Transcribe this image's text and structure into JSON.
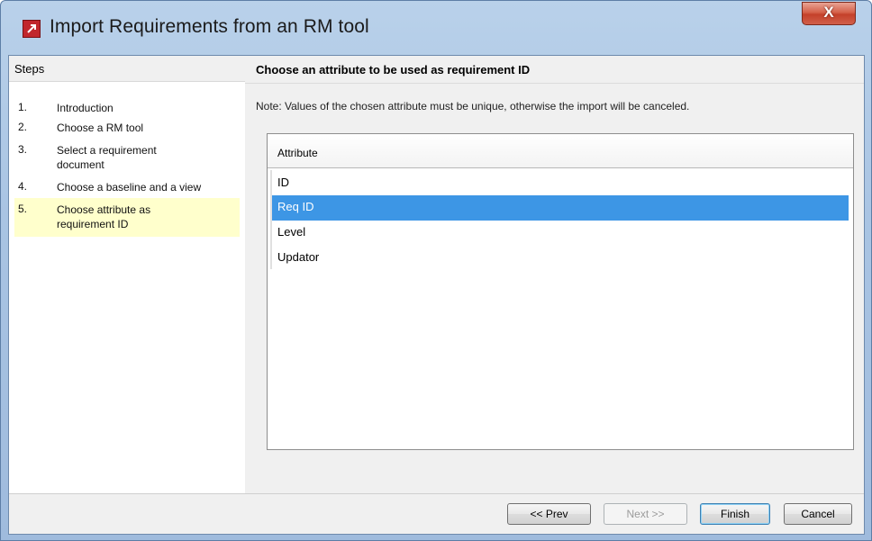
{
  "window": {
    "title": "Import Requirements from an RM tool",
    "app_icon": "import-requirements-app-icon",
    "close_label": "X"
  },
  "steps": {
    "header": "Steps",
    "items": [
      {
        "num": "1.",
        "label": "Introduction",
        "active": false
      },
      {
        "num": "2.",
        "label": "Choose a RM tool",
        "active": false
      },
      {
        "num": "3.",
        "label": "Select a requirement document",
        "active": false
      },
      {
        "num": "4.",
        "label": "Choose a baseline and a view",
        "active": false
      },
      {
        "num": "5.",
        "label": "Choose attribute as requirement ID",
        "active": true
      }
    ]
  },
  "panel": {
    "title": "Choose an attribute to be used as requirement ID",
    "note": "Note: Values of the chosen attribute must be unique, otherwise the import will be canceled.",
    "table": {
      "header": "Attribute",
      "rows": [
        "ID",
        "Req ID",
        "Level",
        "Updator"
      ],
      "selected": "Req ID"
    }
  },
  "footer": {
    "prev": "<< Prev",
    "next": "Next >>",
    "finish": "Finish",
    "cancel": "Cancel"
  },
  "colors": {
    "selection": "#3d96e5",
    "active_step": "#ffffcc",
    "app_icon": "#c1272d",
    "close_button": "#c4402a"
  }
}
